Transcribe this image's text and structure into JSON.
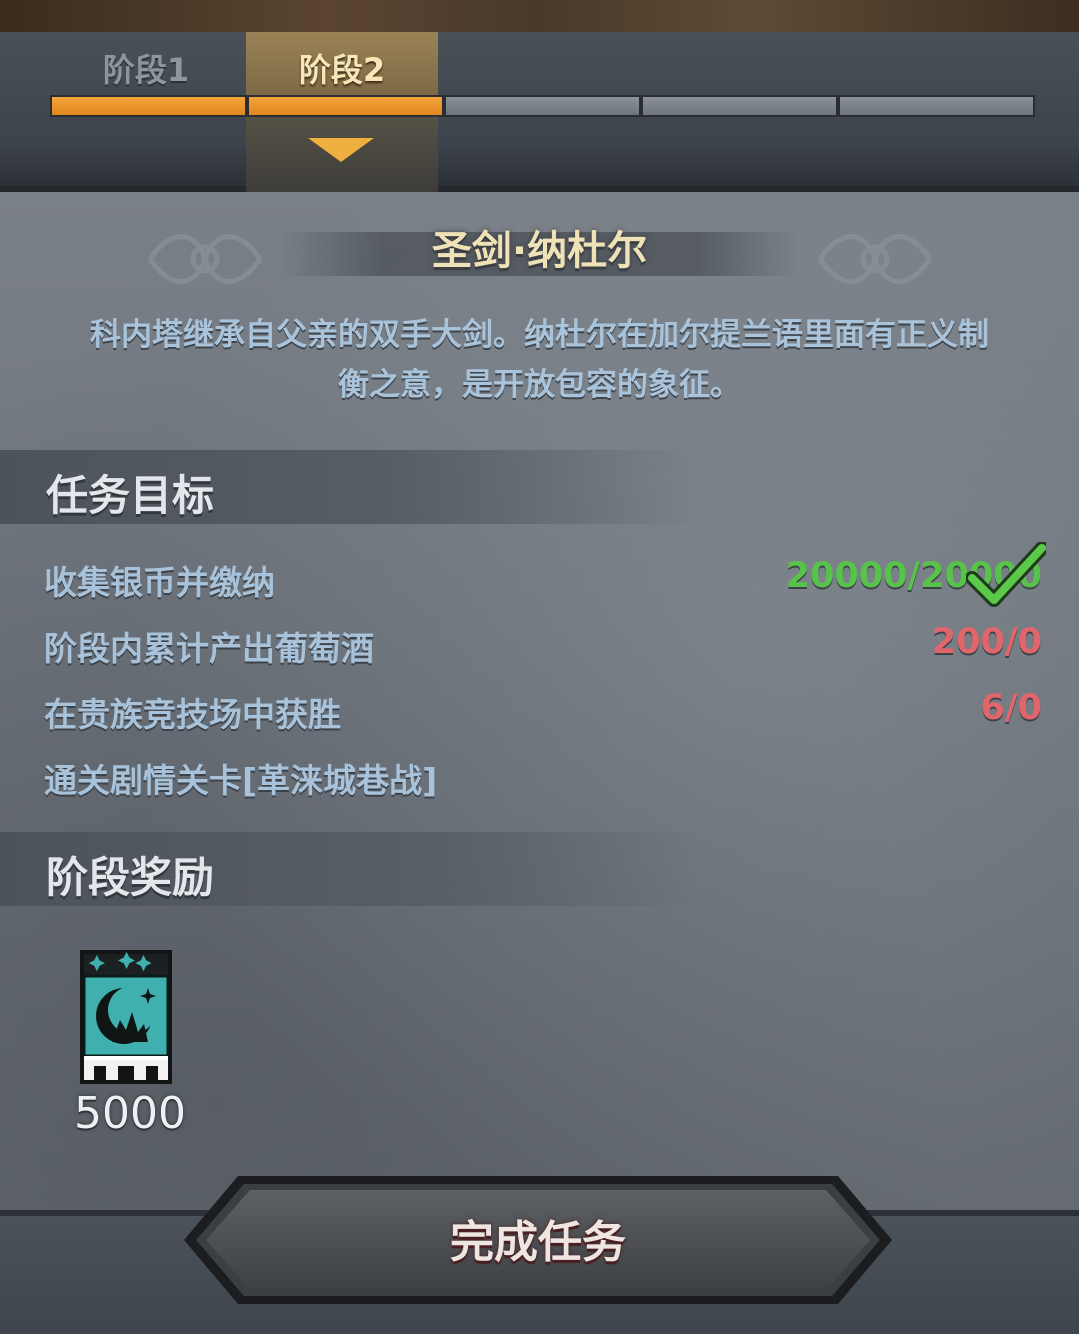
{
  "stages": {
    "tabs": [
      {
        "label": "阶段1"
      },
      {
        "label": "阶段2"
      }
    ],
    "progress_segments_total": 5,
    "progress_segments_done": 2
  },
  "item": {
    "title": "圣剑·纳杜尔",
    "description_line1": "科内塔继承自父亲的双手大剑。纳杜尔在加尔提兰语里面有正义制",
    "description_line2": "衡之意，是开放包容的象征。"
  },
  "objectives": {
    "section_title": "任务目标",
    "items": [
      {
        "label": "收集银币并缴纳",
        "progress": "20000/20000",
        "status": "done"
      },
      {
        "label": "阶段内累计产出葡萄酒",
        "progress": "200/0",
        "status": "pending"
      },
      {
        "label": "在贵族竞技场中获胜",
        "progress": "6/0",
        "status": "pending"
      },
      {
        "label": "通关剧情关卡[革涞城巷战]",
        "progress": "",
        "status": "none"
      }
    ]
  },
  "rewards": {
    "section_title": "阶段奖励",
    "items": [
      {
        "icon": "banner-icon",
        "amount": "5000"
      }
    ]
  },
  "complete_button": {
    "label": "完成任务"
  },
  "colors": {
    "accent_orange": "#f0a030",
    "done_green": "#58c34a",
    "pending_red": "#e0666b",
    "title_gold": "#efe2b6",
    "description_blue": "#a9c3da"
  }
}
